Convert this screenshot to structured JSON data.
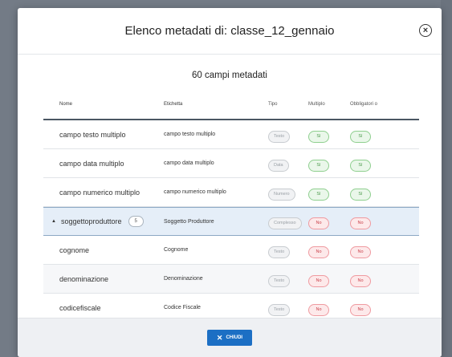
{
  "modal": {
    "title": "Elenco metadati di: classe_12_gennaio",
    "close_icon": "×",
    "count_title": "60 campi metadati",
    "close_button": {
      "icon": "✕",
      "label": "CHIUDI"
    }
  },
  "table": {
    "headers": {
      "nome": "Nome",
      "etichetta": "Etichetta",
      "tipo": "Tipo",
      "multiplo": "Multiplo",
      "obbligatorio": "Obbligatori o"
    },
    "rows": [
      {
        "nome": "campo testo multiplo",
        "etichetta": "campo testo multiplo",
        "tipo": "Testo",
        "multiplo": "Sì",
        "obbligatorio": "Sì"
      },
      {
        "nome": "campo data multiplo",
        "etichetta": "campo data multiplo",
        "tipo": "Data",
        "multiplo": "Sì",
        "obbligatorio": "Sì"
      },
      {
        "nome": "campo numerico multiplo",
        "etichetta": "campo numerico multiplo",
        "tipo": "Numero",
        "multiplo": "Sì",
        "obbligatorio": "Sì"
      },
      {
        "nome": "soggettoproduttore",
        "count": "5",
        "etichetta": "Soggetto Produttore",
        "tipo": "Complesso",
        "multiplo": "No",
        "obbligatorio": "No"
      },
      {
        "nome": "cognome",
        "etichetta": "Cognome",
        "tipo": "Testo",
        "multiplo": "No",
        "obbligatorio": "No"
      },
      {
        "nome": "denominazione",
        "etichetta": "Denominazione",
        "tipo": "Testo",
        "multiplo": "No",
        "obbligatorio": "No"
      },
      {
        "nome": "codicefiscale",
        "etichetta": "Codice Fiscale",
        "tipo": "Testo",
        "multiplo": "No",
        "obbligatorio": "No"
      }
    ]
  },
  "colors": {
    "primary": "#1c6fc4",
    "yes": "#4a9a4a",
    "no": "#c9404a",
    "expanded_bg": "#e5eef8"
  }
}
